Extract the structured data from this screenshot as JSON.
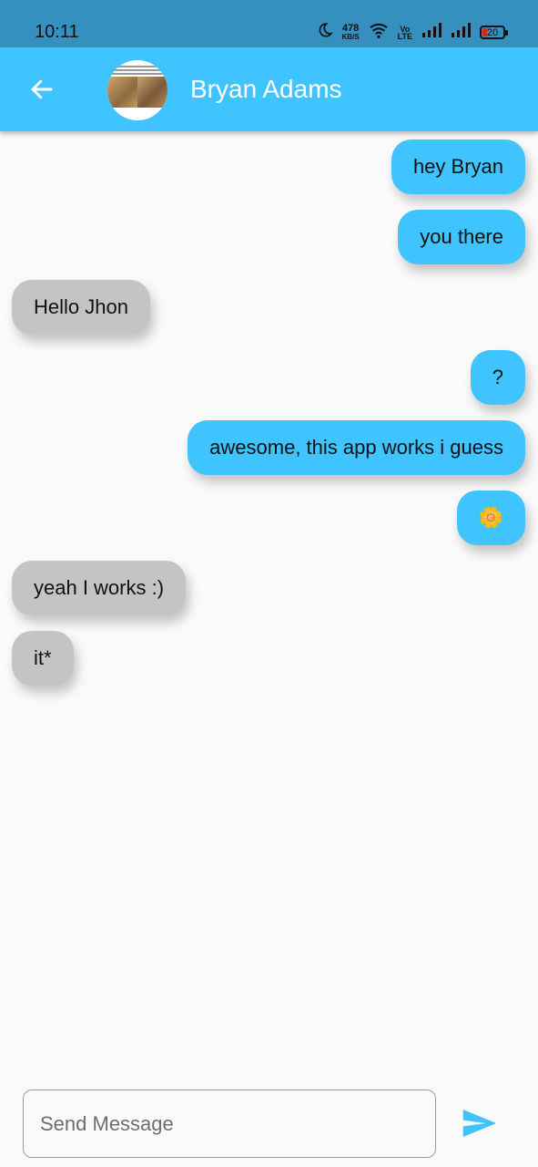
{
  "status_bar": {
    "time": "10:11",
    "net_speed_value": "478",
    "net_speed_unit": "KB/S",
    "volte_top": "Vo",
    "volte_bottom": "LTE",
    "battery_level": "20",
    "icons": [
      "moon-icon",
      "wifi-icon",
      "volte-icon",
      "signal-icon",
      "signal-icon",
      "battery-icon"
    ]
  },
  "header": {
    "back_icon": "arrow-left-icon",
    "contact_name": "Bryan Adams",
    "accent_color": "#40c4ff"
  },
  "messages": [
    {
      "text": "hey Bryan",
      "from": "me"
    },
    {
      "text": "you there",
      "from": "me"
    },
    {
      "text": "Hello Jhon",
      "from": "them"
    },
    {
      "text": "?",
      "from": "me"
    },
    {
      "text": "awesome, this app works i guess",
      "from": "me"
    },
    {
      "text": "🌼",
      "from": "me"
    },
    {
      "text": "yeah I works :)",
      "from": "them"
    },
    {
      "text": "it*",
      "from": "them"
    }
  ],
  "colors": {
    "sent_bubble": "#40c4ff",
    "received_bubble": "#c4c4c4",
    "status_bar": "#3590bf"
  },
  "composer": {
    "placeholder": "Send Message",
    "value": "",
    "send_icon": "send-icon"
  }
}
